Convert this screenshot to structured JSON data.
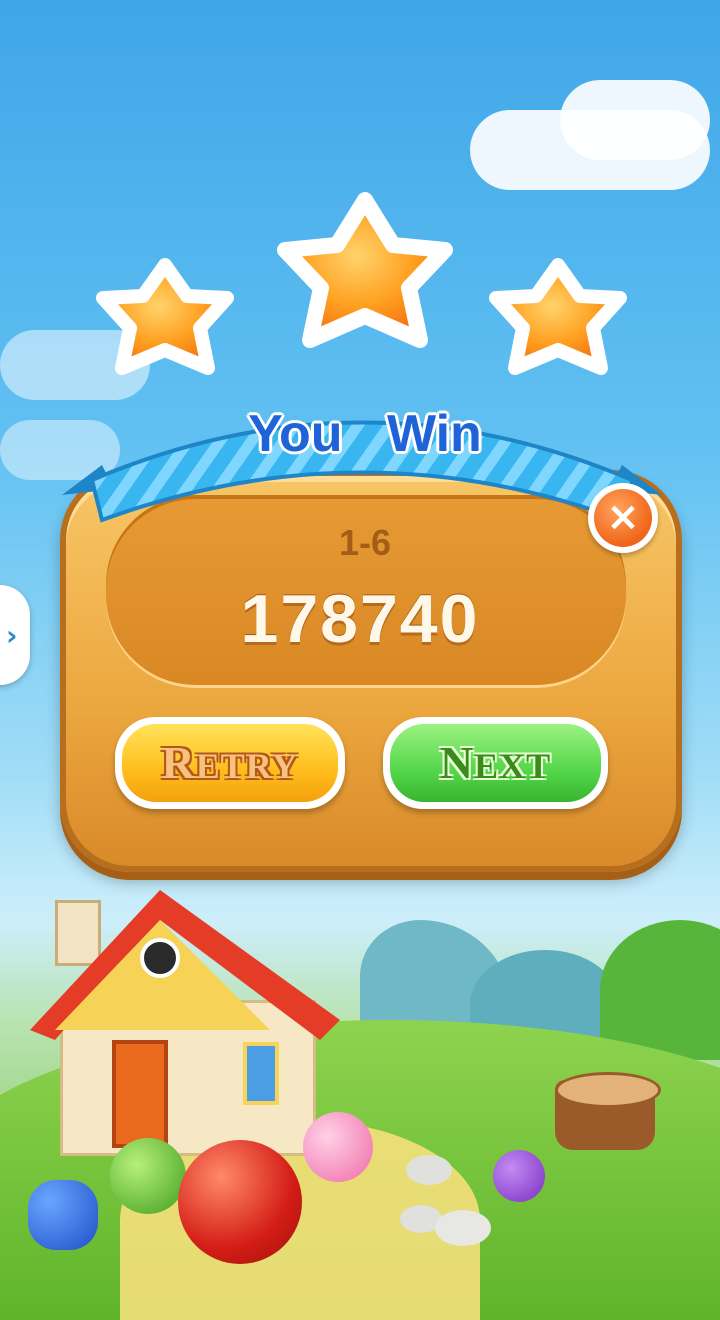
{
  "dialog": {
    "title": "You Win",
    "level": "1-6",
    "score": "178740",
    "stars_earned": 3,
    "stars_total": 3,
    "retry_label": "Retry",
    "next_label": "Next",
    "close_icon": "close-icon"
  },
  "side_tab": {
    "icon": "chevron-right-icon"
  },
  "colors": {
    "ribbon_text": "#1f63d8",
    "star": "#ff9a1a",
    "retry_button": "#ffbd1c",
    "next_button": "#55d64a",
    "close_button": "#f06517"
  }
}
